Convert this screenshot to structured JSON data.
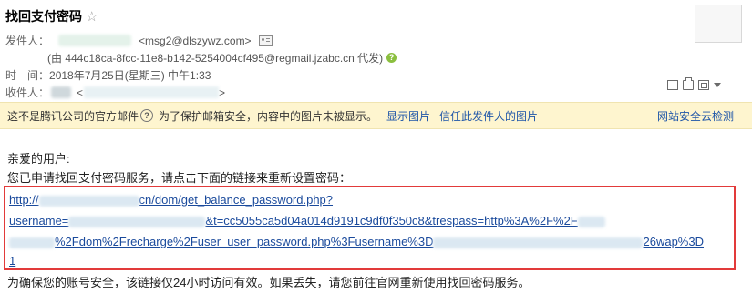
{
  "header": {
    "subject": "找回支付密码",
    "sender": {
      "label": "发件人：",
      "email": "<msg2@dlszywz.com>",
      "via": "(由 444c18ca-8fcc-11e8-b142-5254004cf495@regmail.jzabc.cn 代发)"
    },
    "time": {
      "label": "时　间：",
      "value": "2018年7月25日(星期三) 中午1:33"
    },
    "recipient": {
      "label": "收件人：",
      "open_bracket": "<",
      "close_bracket": ">"
    }
  },
  "notice": {
    "warning": "这不是腾讯公司的官方邮件",
    "protection": "为了保护邮箱安全，内容中的图片未被显示。",
    "show_images": "显示图片",
    "trust_sender": "信任此发件人的图片",
    "security_check": "网站安全云检测"
  },
  "body": {
    "greeting": "亲爱的用户:",
    "intro": "您已申请找回支付密码服务，请点击下面的链接来重新设置密码：",
    "link": {
      "line1_a": "http://",
      "line1_b": "cn/dom/get_balance_password.php?",
      "line2_a": "username=",
      "line2_b": "&t=cc5055ca5d04a014d9191c9df0f350c8&trespass=http%3A%2F%2F",
      "line3_a": "%2Fdom%2Frecharge%2Fuser_user_password.php%3Fusername%3D",
      "line3_b": "26wap%3D",
      "line4": "1"
    },
    "footer": "为确保您的账号安全，该链接仅24小时访问有效。如果丢失，请您前往官网重新使用找回密码服务。"
  },
  "colors": {
    "link": "#1a4a9c",
    "highlight_border": "#e23a3a",
    "notice_bg": "#fef5cf",
    "notice_link": "#1e55a8"
  },
  "icons": [
    "star-icon",
    "contact-card-icon",
    "help-icon",
    "question-icon",
    "new-window-icon",
    "print-icon",
    "expand-icon",
    "dropdown-arrow-icon"
  ]
}
